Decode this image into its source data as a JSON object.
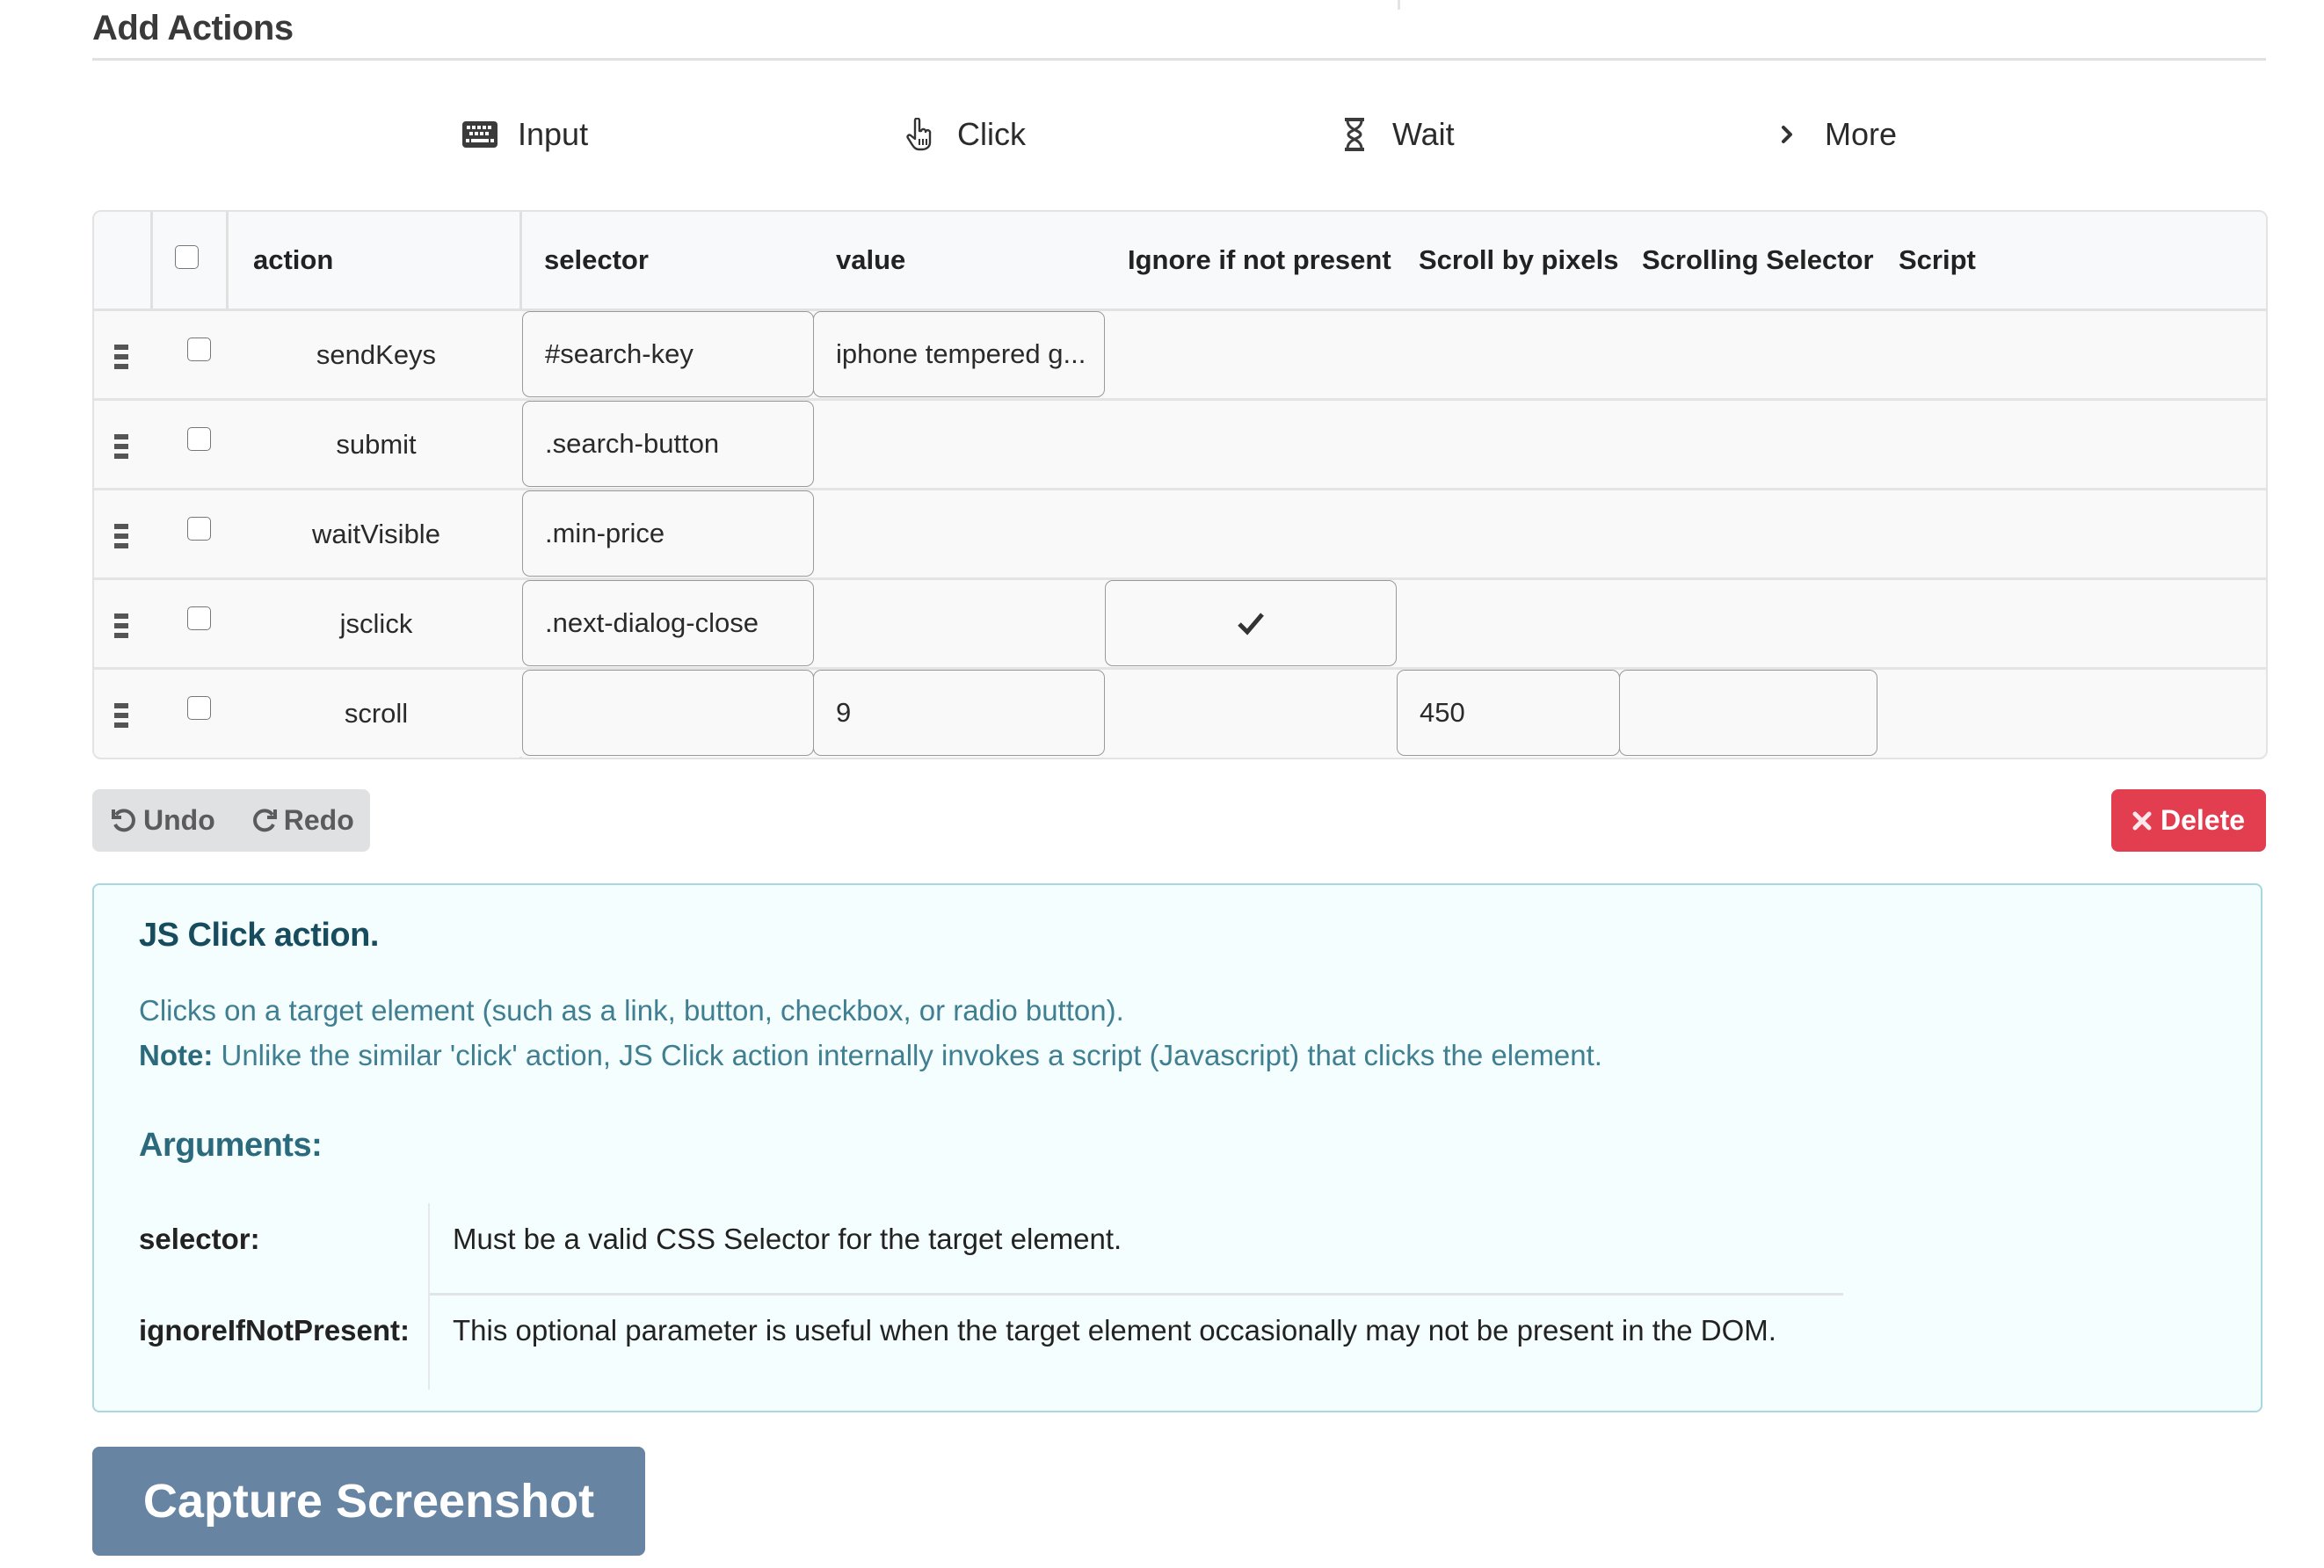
{
  "page": {
    "title": "Add Actions"
  },
  "action_buttons": [
    {
      "label": "Input",
      "icon": "keyboard-icon"
    },
    {
      "label": "Click",
      "icon": "hand-pointer-icon"
    },
    {
      "label": "Wait",
      "icon": "hourglass-icon"
    },
    {
      "label": "More",
      "icon": "chevron-right-icon"
    }
  ],
  "table": {
    "columns": [
      "action",
      "selector",
      "value",
      "Ignore if not present",
      "Scroll by pixels",
      "Scrolling Selector",
      "Script"
    ],
    "select_all_checked": false,
    "rows": [
      {
        "action": "sendKeys",
        "selector": "#search-key",
        "value": "iphone tempered g...",
        "ignore_if_not_present": null,
        "scroll_by_pixels": null,
        "scrolling_selector": null,
        "checked": false
      },
      {
        "action": "submit",
        "selector": ".search-button",
        "value": null,
        "ignore_if_not_present": null,
        "scroll_by_pixels": null,
        "scrolling_selector": null,
        "checked": false
      },
      {
        "action": "waitVisible",
        "selector": ".min-price",
        "value": null,
        "ignore_if_not_present": null,
        "scroll_by_pixels": null,
        "scrolling_selector": null,
        "checked": false
      },
      {
        "action": "jsclick",
        "selector": ".next-dialog-close",
        "value": null,
        "ignore_if_not_present": true,
        "scroll_by_pixels": null,
        "scrolling_selector": null,
        "checked": false
      },
      {
        "action": "scroll",
        "selector": "",
        "value": "9",
        "ignore_if_not_present": null,
        "scroll_by_pixels": "450",
        "scrolling_selector": "",
        "checked": false
      }
    ]
  },
  "toolbar": {
    "undo_label": "Undo",
    "redo_label": "Redo",
    "delete_label": "Delete"
  },
  "info": {
    "title": "JS Click action.",
    "description": "Clicks on a target element (such as a link, button, checkbox, or radio button).",
    "note_label": "Note:",
    "note_text": " Unlike the similar 'click' action, JS Click action internally invokes a script (Javascript) that clicks the element.",
    "arguments_title": "Arguments:",
    "arguments": [
      {
        "name": "selector:",
        "description": "Must be a valid CSS Selector for the target element."
      },
      {
        "name": "ignoreIfNotPresent:",
        "description": "This optional parameter is useful when the target element occasionally may not be present in the DOM."
      }
    ]
  },
  "capture_button": {
    "label": "Capture Screenshot"
  },
  "colors": {
    "delete": "#e23e50",
    "capture": "#6784a2",
    "info_border": "#a9d6df",
    "info_title": "#174c5e",
    "info_text": "#3f7f91"
  }
}
